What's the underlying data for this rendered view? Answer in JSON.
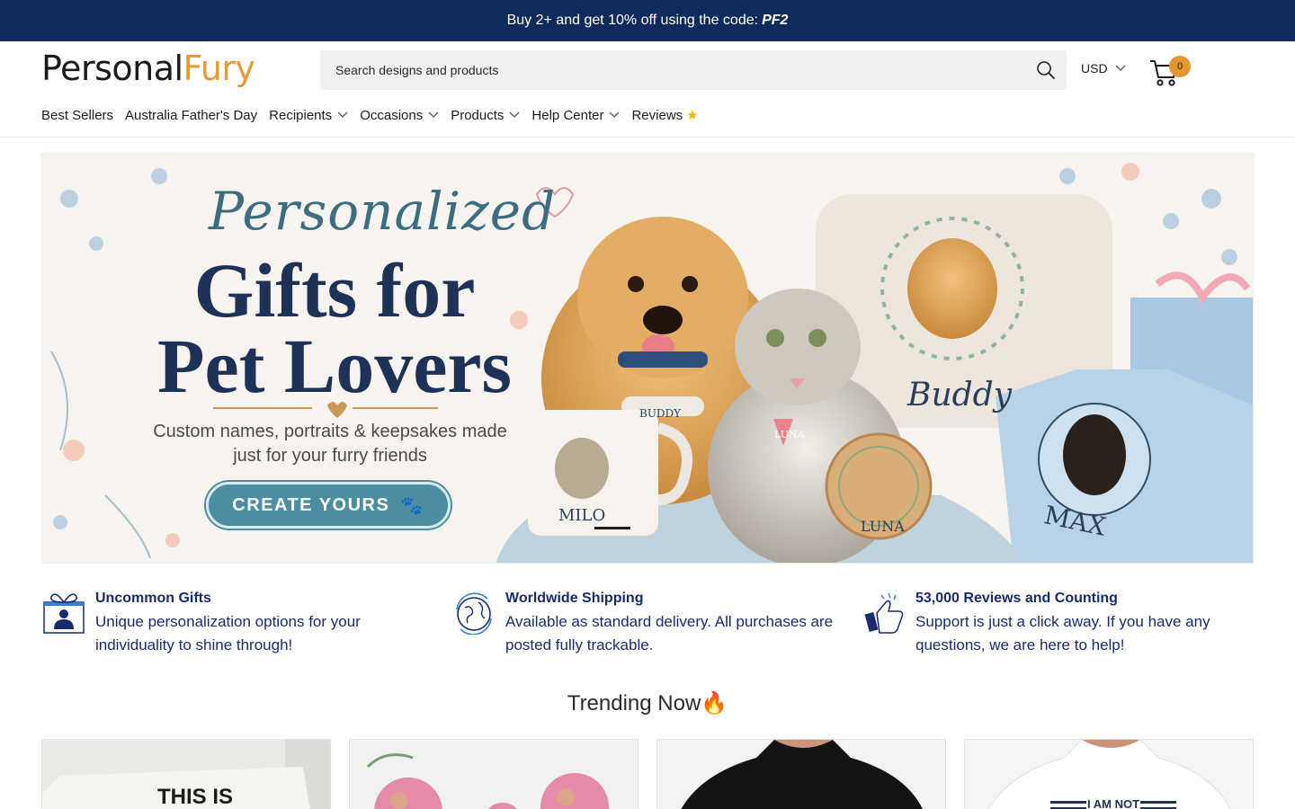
{
  "announcement": {
    "text": "Buy 2+ and get 10% off using the code:",
    "code": "PF2"
  },
  "logo": {
    "part1": "Personal",
    "part2": "Fury"
  },
  "search": {
    "placeholder": "Search designs and products"
  },
  "currency": {
    "value": "USD"
  },
  "cart": {
    "count": "0"
  },
  "nav": {
    "items": [
      {
        "label": "Best Sellers",
        "dropdown": false
      },
      {
        "label": "Australia Father's Day",
        "dropdown": false
      },
      {
        "label": "Recipients",
        "dropdown": true
      },
      {
        "label": "Occasions",
        "dropdown": true
      },
      {
        "label": "Products",
        "dropdown": true
      },
      {
        "label": "Help Center",
        "dropdown": true
      },
      {
        "label": "Reviews",
        "dropdown": false,
        "icon": "star-icon"
      }
    ]
  },
  "hero": {
    "script_title": "Personalized",
    "title": "Gifts for Pet Lovers",
    "subtitle": "Custom names, portraits & keepsakes made just for your furry friends",
    "cta": "CREATE YOURS",
    "names": {
      "mug": "MILO",
      "tag_dog": "BUDDY",
      "tag_cat": "LUNA",
      "ornament": "LUNA",
      "pillow": "Buddy",
      "shirt": "MAX"
    },
    "colors": {
      "title": "#1d3256",
      "script": "#3d6d80",
      "cta": "#4b8ea2"
    }
  },
  "features": [
    {
      "icon": "gift-person-icon",
      "title": "Uncommon Gifts",
      "desc": "Unique personalization options for your individuality to shine through!"
    },
    {
      "icon": "globe-icon",
      "title": "Worldwide Shipping",
      "desc": "Available as standard delivery. All purchases are posted fully trackable."
    },
    {
      "icon": "thumbs-up-icon",
      "title": "53,000 Reviews and Counting",
      "desc": "Support is just a click away. If you have any questions, we are here to help!"
    }
  ],
  "trending": {
    "title": "Trending Now",
    "icon": "fire-icon",
    "cards": [
      "THIS IS",
      "",
      "",
      "I AM NOT"
    ]
  },
  "colors": {
    "announce_bg": "#0f2b5b",
    "accent": "#e6962f",
    "feature_text": "#1a2b6b"
  }
}
